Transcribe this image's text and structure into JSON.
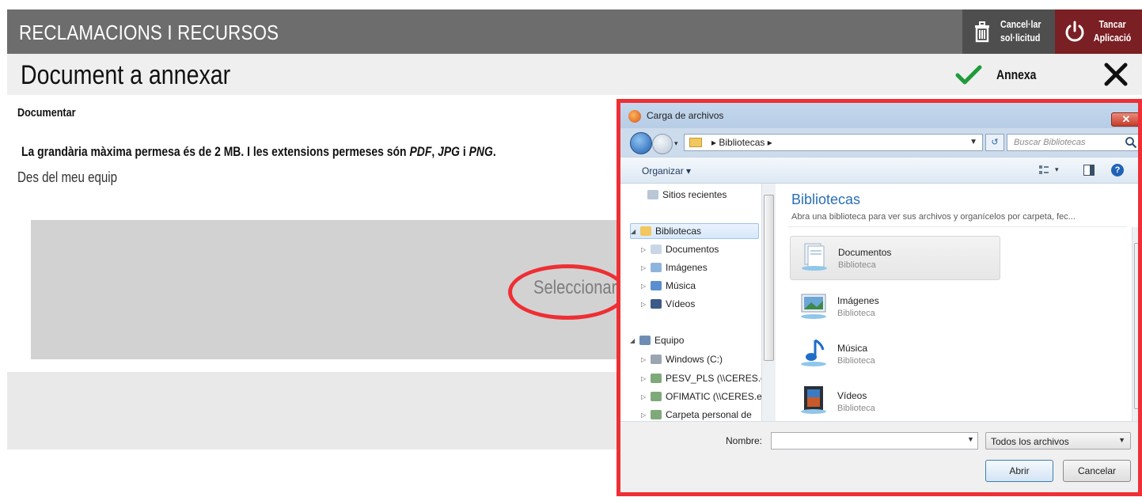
{
  "app": {
    "title": "RECLAMACIONS I RECURSOS",
    "cancel_line1": "Cancel·lar",
    "cancel_line2": "sol·licitud",
    "close_line1": "Tancar",
    "close_line2": "Aplicació"
  },
  "doc": {
    "title": "Document a annexar",
    "annex_label": "Annexa"
  },
  "content": {
    "section_label": "Documentar",
    "info_prefix": "La grandària màxima permesa és de 2 MB. I les extensions permeses són ",
    "ext_pdf": "PDF",
    "sep1": ", ",
    "ext_jpg": "JPG",
    "sep2": " i ",
    "ext_png": "PNG",
    "info_suffix": ".",
    "from_label": "Des del meu equip",
    "select_label": "Seleccionar"
  },
  "dialog": {
    "title": "Carga de archivos",
    "close_glyph": "✕",
    "address": "▸ Bibliotecas ▸",
    "search_placeholder": "Buscar Bibliotecas",
    "organize": "Organizar ▾",
    "nav": [
      {
        "label": "Sitios recientes"
      },
      {
        "label": "Bibliotecas"
      },
      {
        "label": "Documentos"
      },
      {
        "label": "Imágenes"
      },
      {
        "label": "Música"
      },
      {
        "label": "Vídeos"
      },
      {
        "label": "Equipo"
      },
      {
        "label": "Windows (C:)"
      },
      {
        "label": "PESV_PLS (\\\\CERES.e"
      },
      {
        "label": "OFIMATIC (\\\\CERES.e"
      },
      {
        "label": "Carpeta personal de"
      }
    ],
    "pane_title": "Bibliotecas",
    "pane_subtitle": "Abra una biblioteca para ver sus archivos y organícelos por carpeta, fec...",
    "libraries": [
      {
        "name": "Documentos",
        "type": "Biblioteca"
      },
      {
        "name": "Imágenes",
        "type": "Biblioteca"
      },
      {
        "name": "Música",
        "type": "Biblioteca"
      },
      {
        "name": "Vídeos",
        "type": "Biblioteca"
      }
    ],
    "filename_label": "Nombre:",
    "filename_value": "",
    "filetype": "Todos los archivos",
    "open_label": "Abrir",
    "cancel_label": "Cancelar"
  },
  "colors": {
    "header_bg": "#6d6d6d",
    "cancel_bg": "#4e4e4e",
    "close_bg": "#7a1f23",
    "accent_green": "#1e9b3a",
    "highlight_red": "#ee2f35",
    "link_blue": "#2a6fb6"
  }
}
